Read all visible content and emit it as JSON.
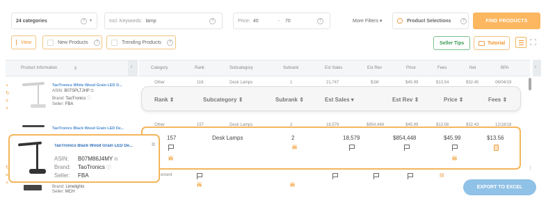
{
  "filters": {
    "categories": "24  categories",
    "keywords_label": "Incl. Keywords:",
    "keywords_value": "lamp",
    "price_label": "Price:",
    "price_min": "40",
    "price_sep": "-",
    "price_max": "70",
    "more_filters": "More Filters",
    "product_selections": "Product Selections",
    "find_products": "FIND PRODUCTS"
  },
  "toolbar": {
    "view": "View",
    "new_products": "New Products",
    "trending_products": "Trending Products",
    "seller_tips": "Seller Tips",
    "tutorial": "Tutorial"
  },
  "table": {
    "product_info_header": "Product Information",
    "headers": [
      "Category",
      "Rank",
      "Subcategory",
      "Subrank",
      "Est Sales",
      "Est Rev",
      "Price",
      "Fees",
      "Net",
      "BPA"
    ],
    "rows": [
      {
        "title": "TaoTronics White Wood Grain LED D...",
        "asin_label": "ASIN:",
        "asin": "B07SPLTJHP",
        "brand_label": "Brand:",
        "brand": "TaoTronics",
        "seller_label": "Seller:",
        "seller": "FBA",
        "cells": [
          "Other",
          "116",
          "Desk Lamps",
          "1",
          "21,747",
          "$1M",
          "$45.99",
          "$13.54",
          "$32.45",
          "06/04/19"
        ]
      },
      {
        "title": "TaoTronics Black Wood Grain LED De...",
        "asin_label": "ASIN:",
        "asin": "B07M86J4MY",
        "brand_label": "Brand:",
        "brand": "TaoTronics",
        "seller_label": "Seller:",
        "seller": "FBA",
        "cells": [
          "Other",
          "157",
          "Desk Lamps",
          "2",
          "18,579",
          "$854,448",
          "$45.99",
          "$13.56",
          "$32.43",
          "12/18/18"
        ]
      },
      {
        "title": "",
        "asin_label": "",
        "asin": "",
        "brand_label": "Brand:",
        "brand": "Limelights",
        "seller_label": "Seller:",
        "seller": "MCH",
        "cells": [
          "Home Improvement",
          "",
          "",
          "",
          "",
          "",
          "",
          "",
          "",
          ""
        ]
      }
    ]
  },
  "sticky_header": [
    "Rank",
    "Subcategory",
    "Subrank",
    "Est Sales",
    "Est Rev",
    "Price",
    "Fees"
  ],
  "highlight_row": {
    "rank": "157",
    "subcategory": "Desk Lamps",
    "subrank": "2",
    "est_sales": "18,579",
    "est_rev": "$854,448",
    "price": "$45.99",
    "fees": "$13.56"
  },
  "highlight_card": {
    "title": "TaoTronics Black Wood Grain LED De...",
    "asin_label": "ASIN:",
    "asin": "B07M86J4MY",
    "brand_label": "Brand:",
    "brand": "TaoTronics",
    "seller_label": "Seller:",
    "seller": "FBA"
  },
  "row3_partial": "ement",
  "export": "EXPORT TO EXCEL",
  "colors": {
    "accent": "#fcb760",
    "highlight_border": "#f3b55a",
    "link": "#4a8ad0",
    "green": "#3a9a52",
    "export": "#90c1e6"
  }
}
